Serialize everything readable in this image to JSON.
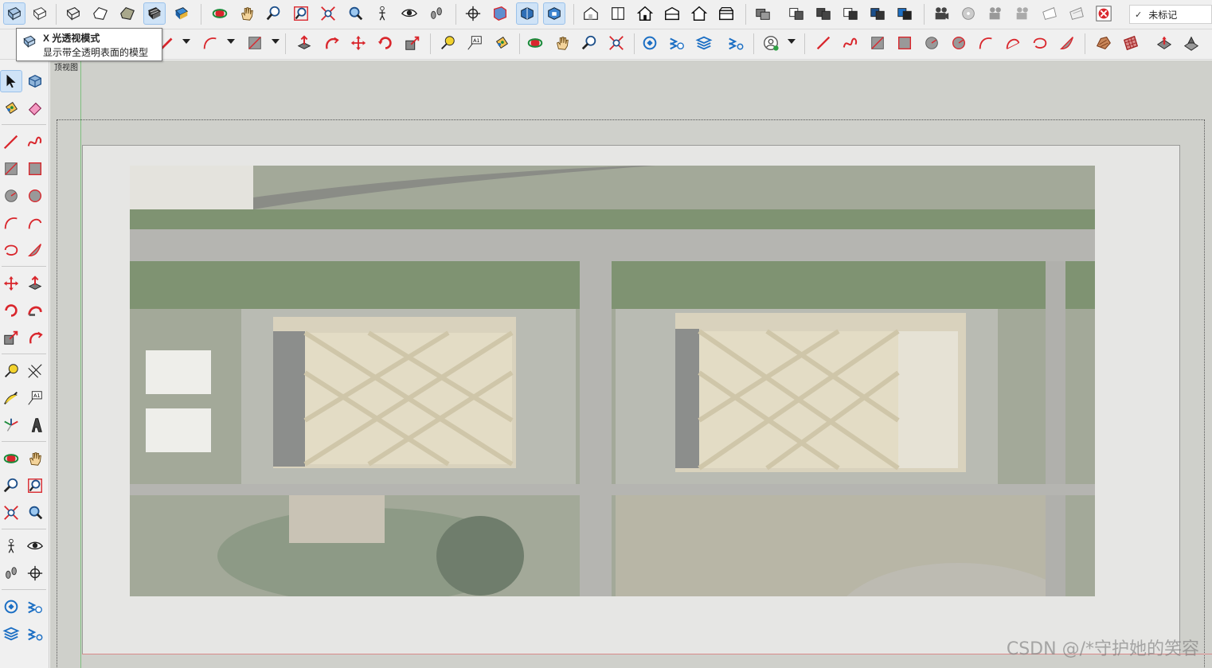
{
  "tooltip": {
    "title": "X 光透视模式",
    "description": "显示带全透明表面的模型",
    "icon": "xray-mode-icon"
  },
  "tag_box": {
    "check": "✓",
    "value": "未标记"
  },
  "viewport": {
    "view_label": "顶视图"
  },
  "watermark": "CSDN @/*守护她的笑容",
  "colors": {
    "viewport_bg": "#cfd0cb",
    "page_bg": "#e6e6e4",
    "active_bg": "#cfe3f7",
    "accent_red": "#d9262c",
    "accent_blue": "#1c6fc4"
  }
}
